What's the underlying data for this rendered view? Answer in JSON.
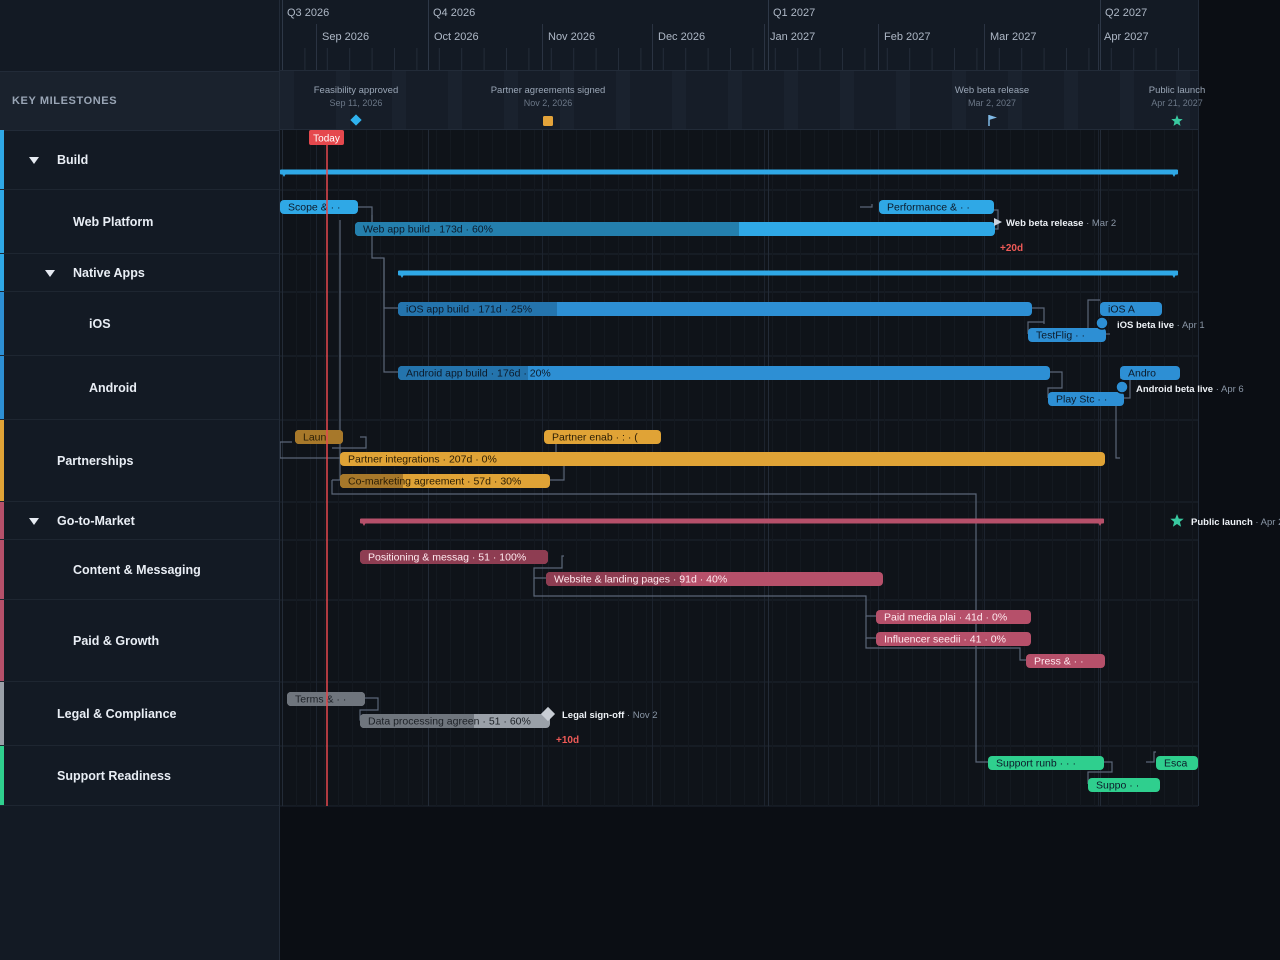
{
  "colors": {
    "build": "#2fa8e6",
    "native": "#2d8fd4",
    "partnership": "#e0a336",
    "gtm": "#b6506a",
    "legal": "#9aa0a8",
    "support": "#2fcf8e",
    "today": "#e5484d",
    "milestone_blue": "#2fb2ee",
    "milestone_orange": "#e3a33a",
    "milestone_teal": "#39c9a0"
  },
  "timeline": {
    "quarters": [
      "Q3 2026",
      "Q4 2026",
      "Q1 2027",
      "Q2 2027"
    ],
    "months": [
      "Sep 2026",
      "Oct 2026",
      "Nov 2026",
      "Dec 2026",
      "Jan 2027",
      "Feb 2027",
      "Mar 2027",
      "Apr 2027"
    ],
    "today_label": "Today"
  },
  "key_milestones": {
    "heading": "KEY MILESTONES",
    "items": [
      {
        "name": "Feasibility approved",
        "date": "Sep 11, 2026",
        "icon": "diamond-icon"
      },
      {
        "name": "Partner agreements signed",
        "date": "Nov 2, 2026",
        "icon": "square-icon"
      },
      {
        "name": "Web beta release",
        "date": "Mar 2, 2027",
        "icon": "flag-icon"
      },
      {
        "name": "Public launch",
        "date": "Apr 21, 2027",
        "icon": "star-icon"
      }
    ]
  },
  "rows": [
    {
      "label": "Build",
      "level": 0,
      "collapsible": true
    },
    {
      "label": "Web Platform",
      "level": 1,
      "collapsible": false
    },
    {
      "label": "Native Apps",
      "level": 1,
      "collapsible": true
    },
    {
      "label": "iOS",
      "level": 2,
      "collapsible": false
    },
    {
      "label": "Android",
      "level": 2,
      "collapsible": false
    },
    {
      "label": "Partnerships",
      "level": 0,
      "collapsible": false
    },
    {
      "label": "Go-to-Market",
      "level": 0,
      "collapsible": true
    },
    {
      "label": "Content & Messaging",
      "level": 1,
      "collapsible": false
    },
    {
      "label": "Paid & Growth",
      "level": 1,
      "collapsible": false
    },
    {
      "label": "Legal & Compliance",
      "level": 0,
      "collapsible": false
    },
    {
      "label": "Support Readiness",
      "level": 0,
      "collapsible": false
    }
  ],
  "tasks": [
    {
      "id": "scope",
      "label": "Scope &",
      "extra": "· ·",
      "progress": 100
    },
    {
      "id": "webapp",
      "label": "Web app build",
      "extra": "· 173d · 60%",
      "progress": 60
    },
    {
      "id": "perf",
      "label": "Performance &",
      "extra": "· ·",
      "progress": 0
    },
    {
      "id": "ios",
      "label": "iOS app build",
      "extra": "· 171d · 25%",
      "progress": 25
    },
    {
      "id": "testflight",
      "label": "TestFlig",
      "extra": "· ·",
      "progress": 0
    },
    {
      "id": "iosapp",
      "label": "iOS A",
      "extra": "",
      "progress": 0
    },
    {
      "id": "android",
      "label": "Android app build",
      "extra": "· 176d · 20%",
      "progress": 20
    },
    {
      "id": "playstore",
      "label": "Play Stc",
      "extra": "· ·",
      "progress": 0
    },
    {
      "id": "androidrel",
      "label": "Andro",
      "extra": "",
      "progress": 0
    },
    {
      "id": "launchpart",
      "label": "Laun",
      "extra": "",
      "progress": 100
    },
    {
      "id": "partnerenab",
      "label": "Partner enab",
      "extra": "· : · (",
      "progress": 0
    },
    {
      "id": "partnerint",
      "label": "Partner integrations",
      "extra": "· 207d · 0%",
      "progress": 0
    },
    {
      "id": "comarketing",
      "label": "Co-marketing agreement",
      "extra": "· 57d · 30%",
      "progress": 30
    },
    {
      "id": "positioning",
      "label": "Positioning & messag",
      "extra": "· 51 · 100%",
      "progress": 100
    },
    {
      "id": "website",
      "label": "Website & landing pages",
      "extra": "· 91d · 40%",
      "progress": 40
    },
    {
      "id": "paidmedia",
      "label": "Paid media plai",
      "extra": "· 41d · 0%",
      "progress": 0
    },
    {
      "id": "influencer",
      "label": "Influencer seedii",
      "extra": "· 41 · 0%",
      "progress": 0
    },
    {
      "id": "press",
      "label": "Press &",
      "extra": "· ·",
      "progress": 0
    },
    {
      "id": "terms",
      "label": "Terms &",
      "extra": "· ·",
      "progress": 100
    },
    {
      "id": "dataproc",
      "label": "Data processing agreen",
      "extra": "· 51 · 60%",
      "progress": 60
    },
    {
      "id": "supportrun",
      "label": "Support runb",
      "extra": "· · ·",
      "progress": 0
    },
    {
      "id": "escalation",
      "label": "Esca",
      "extra": "",
      "progress": 0
    },
    {
      "id": "supportb",
      "label": "Suppo",
      "extra": "· ·",
      "progress": 0
    }
  ],
  "inline_milestones": [
    {
      "id": "webbeta",
      "name": "Web beta release",
      "date": "Mar 2",
      "slip": "+20d"
    },
    {
      "id": "iosbeta",
      "name": "iOS beta live",
      "date": "Apr 1",
      "slip": ""
    },
    {
      "id": "androidbeta",
      "name": "Android beta live",
      "date": "Apr 6",
      "slip": ""
    },
    {
      "id": "legalsignoff",
      "name": "Legal sign-off",
      "date": "Nov 2",
      "slip": "+10d"
    },
    {
      "id": "publiclaunch",
      "name": "Public launch",
      "date": "Apr 2",
      "slip": ""
    }
  ]
}
